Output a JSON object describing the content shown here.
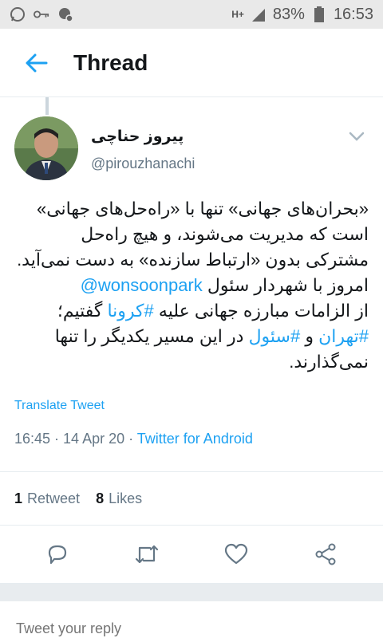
{
  "status_bar": {
    "network": "H+",
    "battery": "83%",
    "time": "16:53",
    "icons": [
      "whatsapp-icon",
      "key-icon",
      "no-network-icon",
      "signal-icon",
      "battery-icon"
    ]
  },
  "app_bar": {
    "title": "Thread"
  },
  "tweet": {
    "name": "پیروز حناچی",
    "handle": "@pirouzhanachi",
    "body_lines": [
      "«بحران‌های جهانی» تنها با «راه‌حل‌های جهانی»",
      "است که مدیریت می‌شوند، و هیچ راه‌حل",
      "مشترکی بدون «ارتباط سازنده» به دست نمی‌آید.",
      "امروز با شهردار سئول ",
      "از الزامات مبارزه جهانی علیه ",
      " گفتیم؛",
      " و ",
      " در این مسیر یکدیگر را تنها",
      "نمی‌گذارند."
    ],
    "mention": "@wonsoonpark",
    "hashtag_corona": "#کرونا",
    "hashtag_tehran": "#تهران",
    "hashtag_seoul": "#سئول",
    "translate_label": "Translate Tweet",
    "timestamp": "16:45 · 14 Apr 20 · ",
    "source": "Twitter for Android",
    "retweets_count": "1",
    "retweets_label": "Retweet",
    "likes_count": "8",
    "likes_label": "Likes"
  },
  "reply": {
    "placeholder": "Tweet your reply"
  },
  "colors": {
    "accent": "#1da1f2",
    "text": "#14171a",
    "secondary": "#657786"
  }
}
